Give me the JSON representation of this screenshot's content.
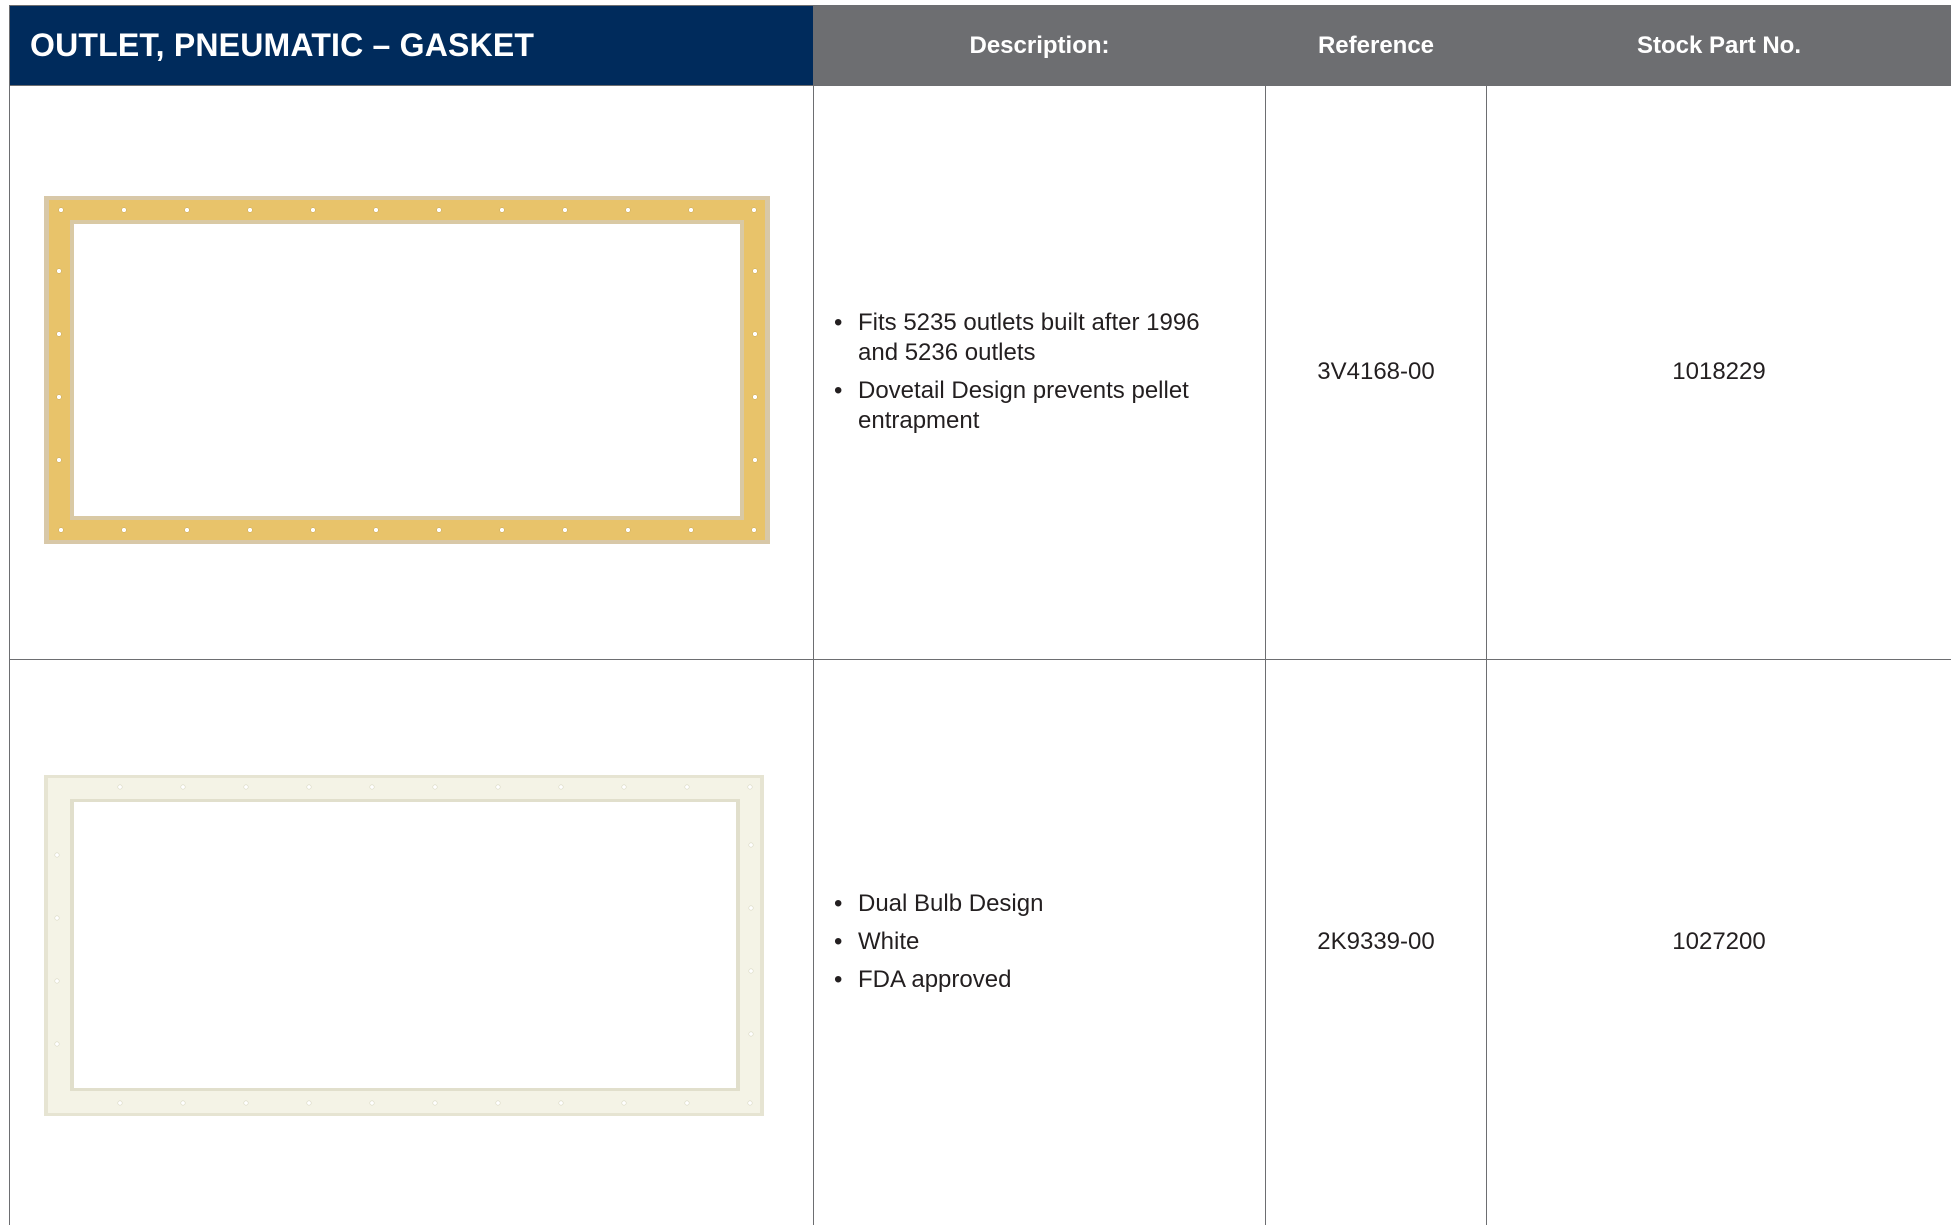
{
  "header": {
    "title": "OUTLET, PNEUMATIC – GASKET",
    "description_label": "Description:",
    "reference_label": "Reference",
    "stock_label": "Stock Part No."
  },
  "colors": {
    "title_bg": "#002b5c",
    "header_bg": "#6d6e71",
    "gasket_tan": "#e8c36a",
    "gasket_white": "#f4f3e6"
  },
  "rows": [
    {
      "image": "tan-rectangular-gasket-image",
      "description": [
        "Fits 5235 outlets built after 1996 and 5236 outlets",
        "Dovetail Design prevents pellet entrapment"
      ],
      "reference": "3V4168-00",
      "stock_part_no": "1018229"
    },
    {
      "image": "white-rectangular-gasket-image",
      "description": [
        "Dual Bulb Design",
        "White",
        "FDA approved"
      ],
      "reference": "2K9339-00",
      "stock_part_no": "1027200"
    }
  ]
}
